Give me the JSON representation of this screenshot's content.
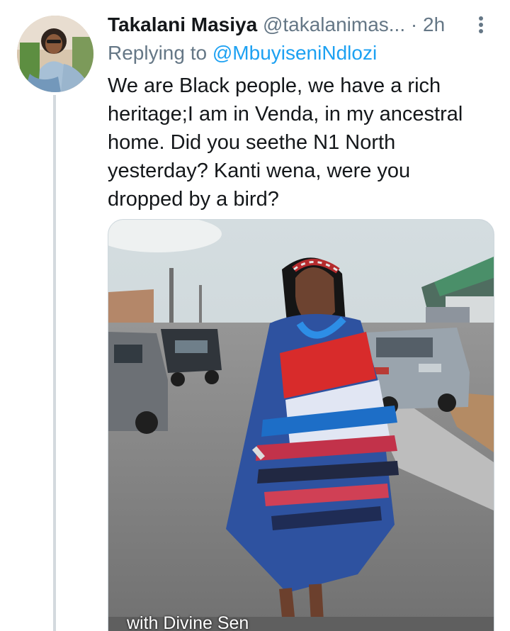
{
  "tweet": {
    "display_name": "Takalani Masiya",
    "handle": "@takalanimas...",
    "separator": "·",
    "time": "2h",
    "replying_prefix": "Replying to",
    "replying_to": "@MbuyiseniNdlozi",
    "body_lines": [
      "We are Black people, we have a rich",
      "heritage;I am in Venda, in my ancestral",
      "home. Did you seethe N1 North",
      "yesterday? Kanti wena, were you",
      "dropped by a bird?"
    ],
    "media_caption": "with Divine Sen",
    "colors": {
      "text": "#14171a",
      "secondary": "#657786",
      "link": "#1da1f2",
      "thread_line": "#d3d9de",
      "border": "#cfd8de"
    },
    "icons": {
      "more": "more-vertical-icon"
    }
  }
}
